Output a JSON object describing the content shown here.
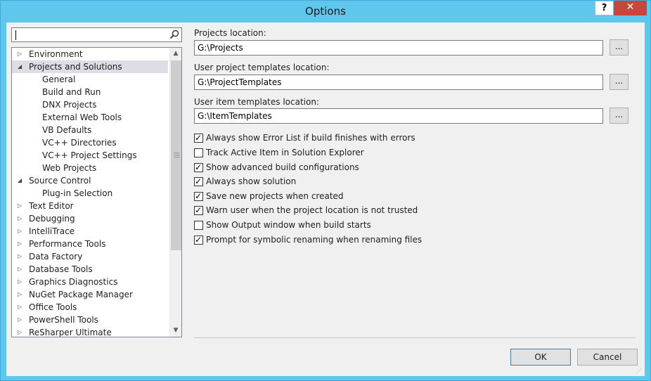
{
  "window": {
    "title": "Options"
  },
  "titlebar": {
    "help": "?",
    "close": "✕"
  },
  "search": {
    "value": "",
    "placeholder": ""
  },
  "tree": {
    "items": [
      {
        "label": "Environment",
        "level": 0,
        "state": "collapsed",
        "selected": false
      },
      {
        "label": "Projects and Solutions",
        "level": 0,
        "state": "expanded",
        "selected": true
      },
      {
        "label": "General",
        "level": 1,
        "state": "leaf",
        "selected": false
      },
      {
        "label": "Build and Run",
        "level": 1,
        "state": "leaf",
        "selected": false
      },
      {
        "label": "DNX Projects",
        "level": 1,
        "state": "leaf",
        "selected": false
      },
      {
        "label": "External Web Tools",
        "level": 1,
        "state": "leaf",
        "selected": false
      },
      {
        "label": "VB Defaults",
        "level": 1,
        "state": "leaf",
        "selected": false
      },
      {
        "label": "VC++ Directories",
        "level": 1,
        "state": "leaf",
        "selected": false
      },
      {
        "label": "VC++ Project Settings",
        "level": 1,
        "state": "leaf",
        "selected": false
      },
      {
        "label": "Web Projects",
        "level": 1,
        "state": "leaf",
        "selected": false
      },
      {
        "label": "Source Control",
        "level": 0,
        "state": "expanded",
        "selected": false
      },
      {
        "label": "Plug-in Selection",
        "level": 1,
        "state": "leaf",
        "selected": false
      },
      {
        "label": "Text Editor",
        "level": 0,
        "state": "collapsed",
        "selected": false
      },
      {
        "label": "Debugging",
        "level": 0,
        "state": "collapsed",
        "selected": false
      },
      {
        "label": "IntelliTrace",
        "level": 0,
        "state": "collapsed",
        "selected": false
      },
      {
        "label": "Performance Tools",
        "level": 0,
        "state": "collapsed",
        "selected": false
      },
      {
        "label": "Data Factory",
        "level": 0,
        "state": "collapsed",
        "selected": false
      },
      {
        "label": "Database Tools",
        "level": 0,
        "state": "collapsed",
        "selected": false
      },
      {
        "label": "Graphics Diagnostics",
        "level": 0,
        "state": "collapsed",
        "selected": false
      },
      {
        "label": "NuGet Package Manager",
        "level": 0,
        "state": "collapsed",
        "selected": false
      },
      {
        "label": "Office Tools",
        "level": 0,
        "state": "collapsed",
        "selected": false
      },
      {
        "label": "PowerShell Tools",
        "level": 0,
        "state": "collapsed",
        "selected": false
      },
      {
        "label": "ReSharper Ultimate",
        "level": 0,
        "state": "collapsed",
        "selected": false
      }
    ]
  },
  "settings": {
    "projects_location": {
      "label": "Projects location:",
      "value": "G:\\Projects",
      "browse": "..."
    },
    "project_templates": {
      "label": "User project templates location:",
      "value": "G:\\ProjectTemplates",
      "browse": "..."
    },
    "item_templates": {
      "label": "User item templates location:",
      "value": "G:\\ItemTemplates",
      "browse": "..."
    },
    "checkboxes": [
      {
        "label": "Always show Error List if build finishes with errors",
        "checked": true
      },
      {
        "label": "Track Active Item in Solution Explorer",
        "checked": false
      },
      {
        "label": "Show advanced build configurations",
        "checked": true
      },
      {
        "label": "Always show solution",
        "checked": true
      },
      {
        "label": "Save new projects when created",
        "checked": true
      },
      {
        "label": "Warn user when the project location is not trusted",
        "checked": true
      },
      {
        "label": "Show Output window when build starts",
        "checked": false
      },
      {
        "label": "Prompt for symbolic renaming when renaming files",
        "checked": true
      }
    ]
  },
  "buttons": {
    "ok": "OK",
    "cancel": "Cancel"
  },
  "colors": {
    "titlebar": "#5fc6ec",
    "close": "#c7473d",
    "selection": "#dcdde5"
  }
}
